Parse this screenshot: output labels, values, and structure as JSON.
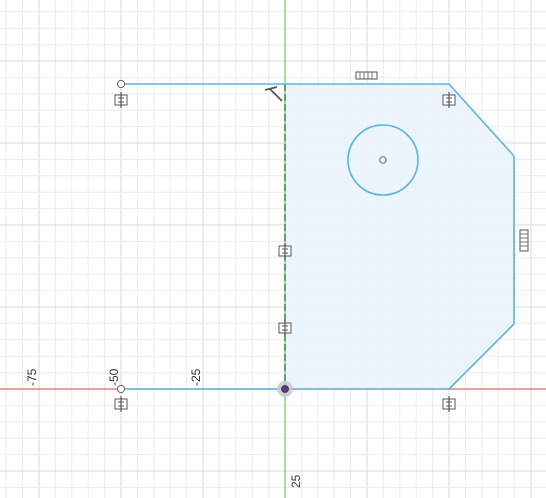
{
  "axis_labels": {
    "x_neg_75": "-75",
    "x_neg_50": "-50",
    "x_neg_25": "-25",
    "y_25": "25"
  },
  "constraint_icons": {
    "horizontal": "horizontal-constraint-icon",
    "vertical": "vertical-constraint-icon",
    "fix": "fix-constraint-icon",
    "tangent": "tangent-constraint-icon"
  },
  "colors": {
    "grid_minor": "#ececec",
    "grid_major": "#d9d9d9",
    "x_axis": "#e06666",
    "y_axis": "#66cc66",
    "sketch_line": "#5ab4e0",
    "profile_fill": "#eaf4fb",
    "origin": "#5a3d8a"
  }
}
